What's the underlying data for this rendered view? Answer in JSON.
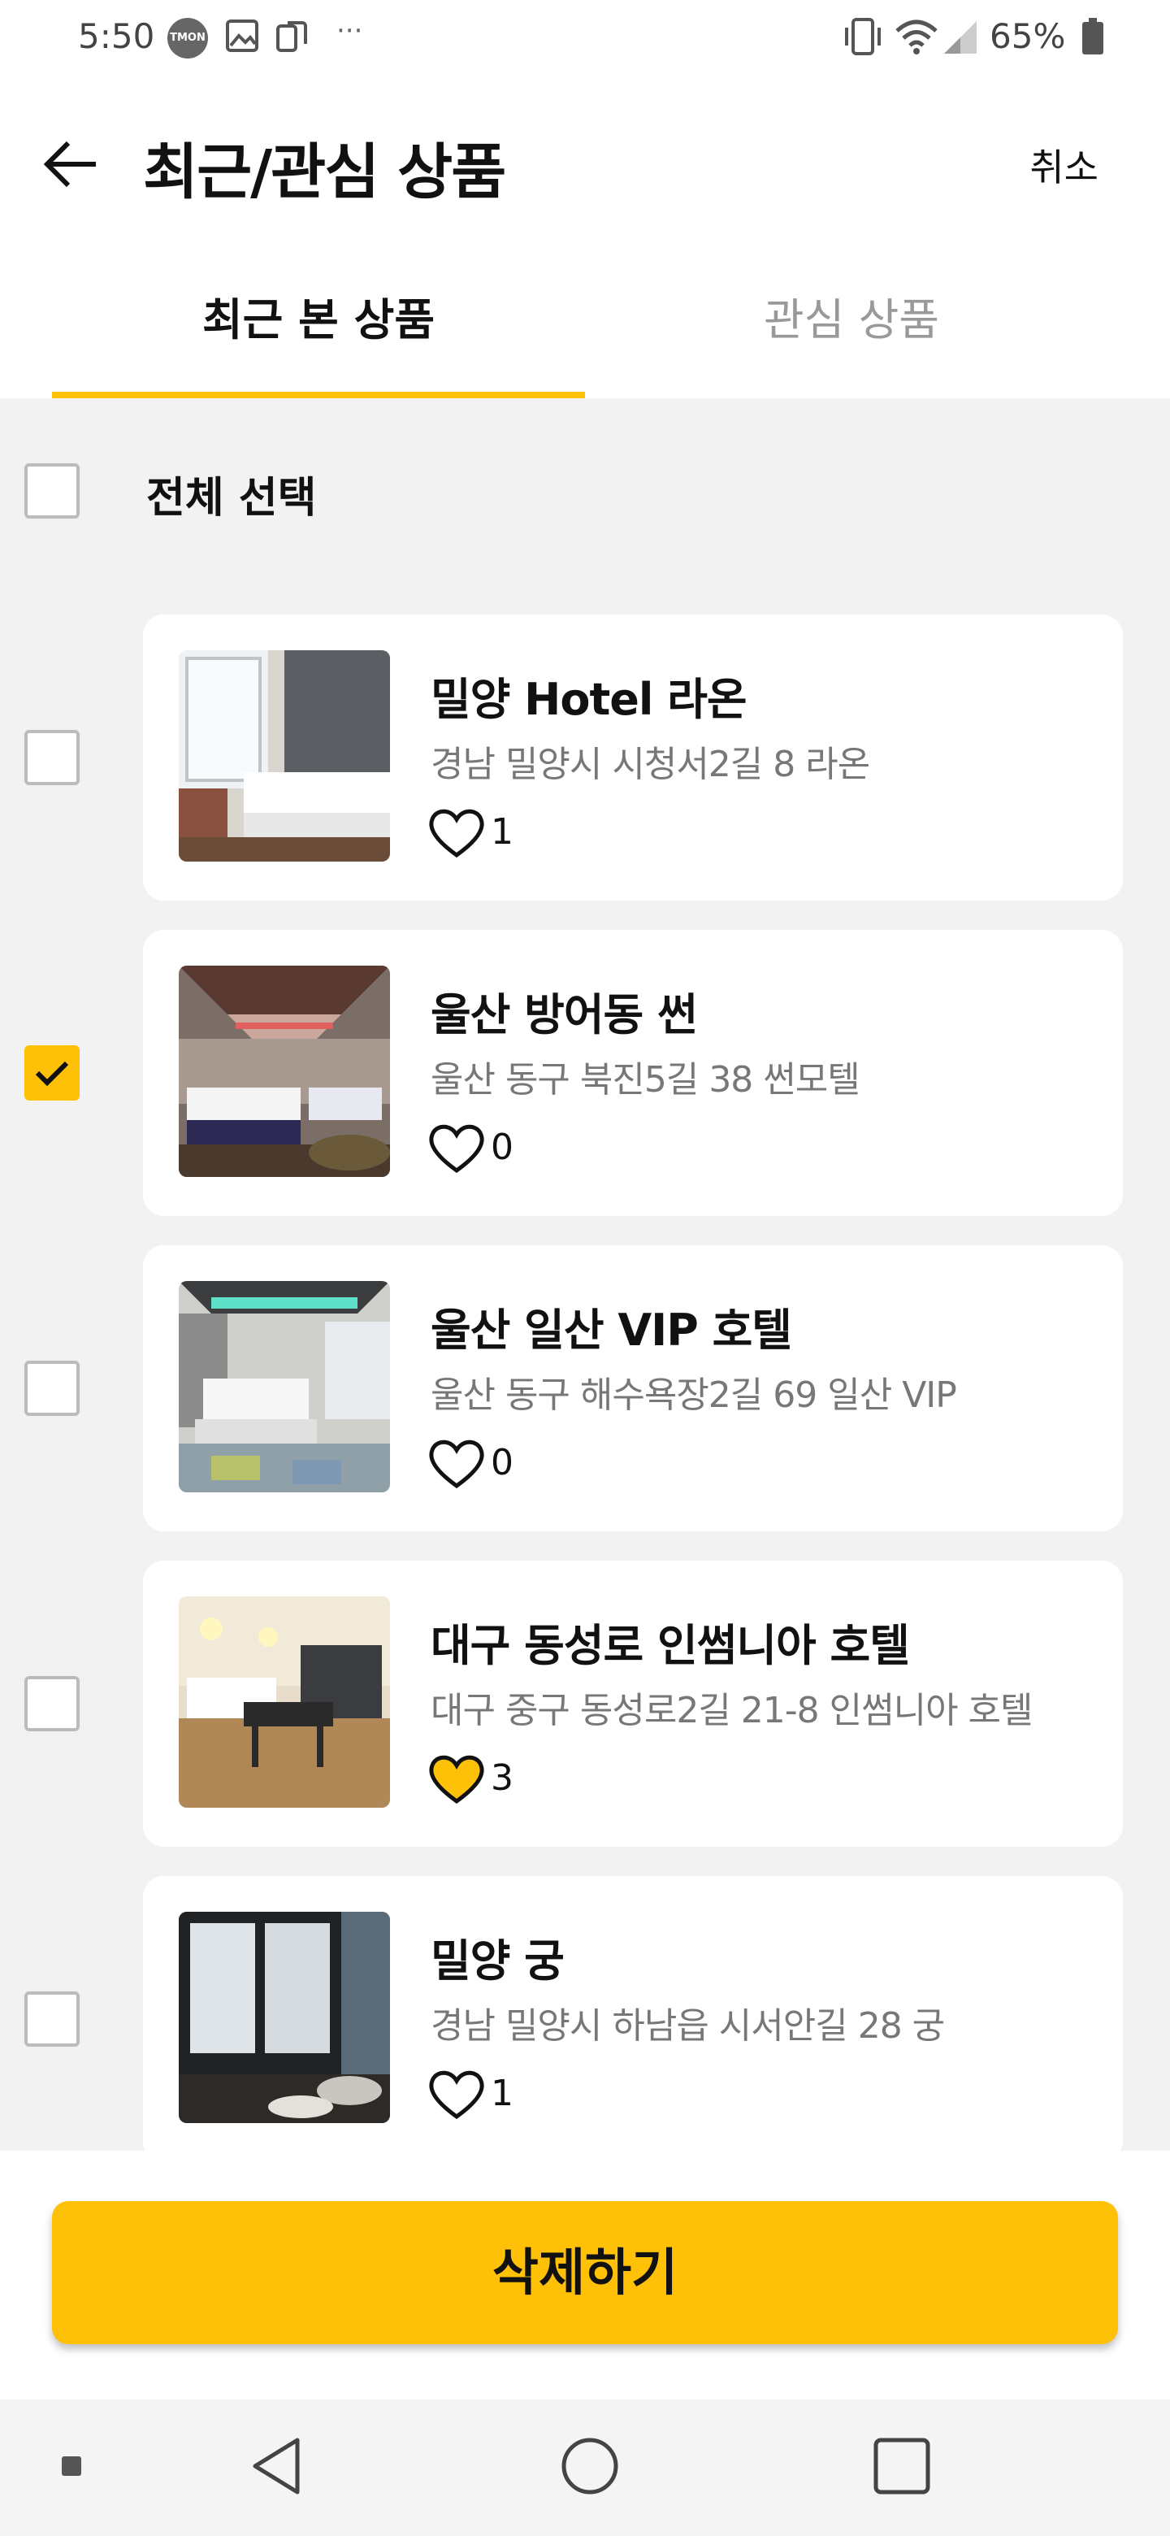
{
  "status_bar": {
    "time": "5:50",
    "tmon_badge": "TMON",
    "more": "···",
    "battery": "65%"
  },
  "header": {
    "title": "최근/관심 상품",
    "cancel_label": "취소"
  },
  "tabs": [
    {
      "label": "최근 본 상품",
      "active": true
    },
    {
      "label": "관심 상품",
      "active": false
    }
  ],
  "select_all": {
    "label": "전체 선택",
    "checked": false
  },
  "items": [
    {
      "name": "밀양 Hotel 라온",
      "address": "경남 밀양시 시청서2길 8 라온",
      "likes": "1",
      "liked": false,
      "checked": false
    },
    {
      "name": "울산 방어동 썬",
      "address": "울산 동구 북진5길 38 썬모텔",
      "likes": "0",
      "liked": false,
      "checked": true
    },
    {
      "name": "울산 일산 VIP 호텔",
      "address": "울산 동구 해수욕장2길 69 일산 VIP",
      "likes": "0",
      "liked": false,
      "checked": false
    },
    {
      "name": "대구 동성로 인썸니아 호텔",
      "address": "대구 중구 동성로2길 21-8 인썸니아 호텔",
      "likes": "3",
      "liked": true,
      "checked": false
    },
    {
      "name": "밀양 궁",
      "address": "경남 밀양시 하남읍 시서안길 28 궁",
      "likes": "1",
      "liked": false,
      "checked": false
    }
  ],
  "delete_button": {
    "label": "삭제하기"
  },
  "colors": {
    "accent": "#ffc107",
    "muted_text": "#777777",
    "background": "#f2f2f2"
  }
}
